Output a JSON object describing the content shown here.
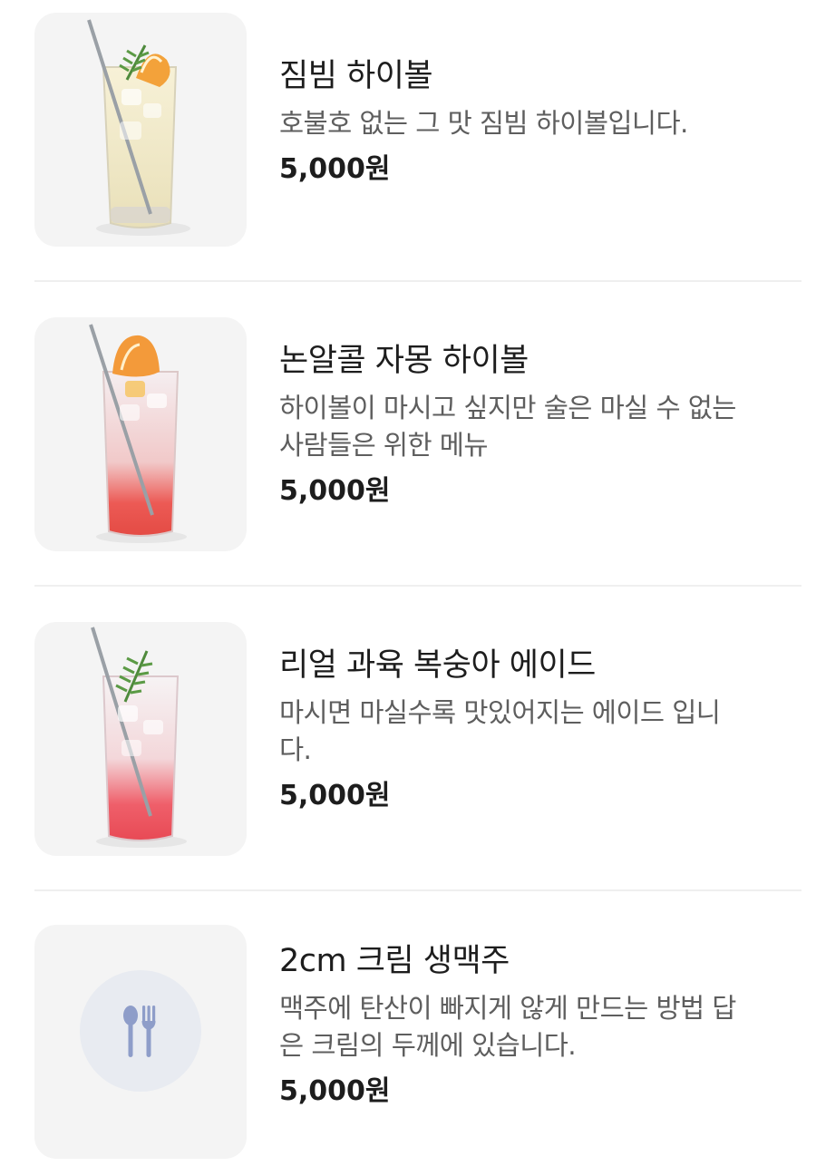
{
  "menu": {
    "items": [
      {
        "name": "짐빔 하이볼",
        "description_lines": [
          "호불호 없는 그 맛 짐빔 하이볼입니다."
        ],
        "price": "5,000원",
        "image": "highball-glass-lemon-rosemary"
      },
      {
        "name": "논알콜 자몽 하이볼",
        "description_lines": [
          "하이볼이 마시고 싶지만 술은 마실 수 없는",
          "사람들은 위한 메뉴"
        ],
        "price": "5,000원",
        "image": "grapefruit-highball-glass"
      },
      {
        "name": "리얼 과육 복숭아 에이드",
        "description_lines": [
          "마시면 마실수록 맛있어지는 에이드 입니",
          "다."
        ],
        "price": "5,000원",
        "image": "peach-ade-glass-rosemary"
      },
      {
        "name": "2cm 크림 생맥주",
        "description_lines": [
          "맥주에 탄산이 빠지게 않게 만드는 방법 답",
          "은 크림의 두께에 있습니다."
        ],
        "price": "5,000원",
        "image": "spoon-fork-placeholder-icon"
      }
    ]
  },
  "colors": {
    "thumbnail_bg": "#f4f4f4",
    "placeholder_circle": "#e8ebf1",
    "placeholder_icon": "#8e9dc9",
    "divider": "#efefef"
  }
}
